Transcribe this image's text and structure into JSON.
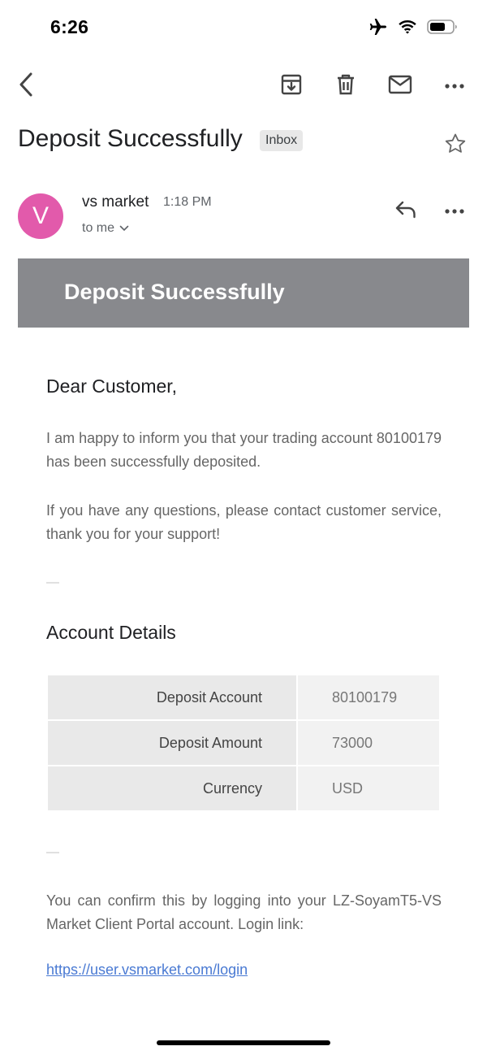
{
  "status_bar": {
    "time": "6:26",
    "icons": [
      "airplane-icon",
      "wifi-icon",
      "battery-icon"
    ]
  },
  "toolbar": {
    "icons": [
      "back-arrow-icon",
      "archive-icon",
      "trash-icon",
      "mail-icon",
      "more-horizontal-icon"
    ]
  },
  "email": {
    "subject": "Deposit Successfully",
    "label": "Inbox",
    "sender_name": "vs market",
    "sender_initial": "V",
    "time": "1:18 PM",
    "recipient": "to me",
    "avatar_color": "#e25aab"
  },
  "message": {
    "banner_title": "Deposit Successfully",
    "banner_color": "#88898d",
    "greeting": "Dear Customer,",
    "paragraph1": "I am happy to inform you that your trading account 80100179 has been successfully deposited.",
    "paragraph2": "If you have any questions, please contact customer service, thank you for your support!",
    "details_heading": "Account Details",
    "details": [
      {
        "label": "Deposit Account",
        "value": "80100179"
      },
      {
        "label": "Deposit Amount",
        "value": "73000"
      },
      {
        "label": "Currency",
        "value": "USD"
      }
    ],
    "footer": "You can confirm this by logging into your LZ-SoyamT5-VS Market Client Portal account. Login link:",
    "login_link": "https://user.vsmarket.com/login",
    "link_color": "#4a7ad3"
  }
}
